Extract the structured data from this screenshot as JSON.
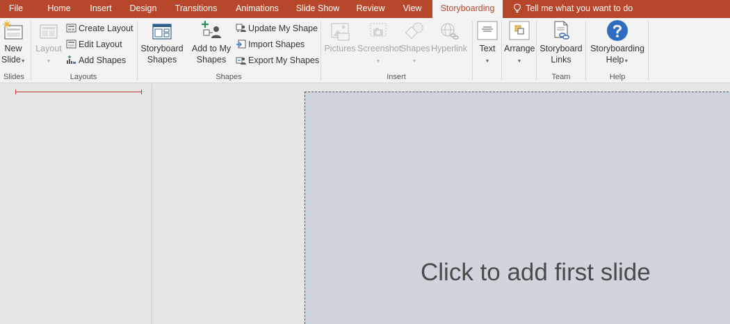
{
  "tabs": {
    "file": "File",
    "home": "Home",
    "insert": "Insert",
    "design": "Design",
    "transitions": "Transitions",
    "animations": "Animations",
    "slideshow": "Slide Show",
    "review": "Review",
    "view": "View",
    "storyboarding": "Storyboarding",
    "tellme": "Tell me what you want to do"
  },
  "ribbon": {
    "slides": {
      "group_label": "Slides",
      "new_slide_line1": "New",
      "new_slide_line2": "Slide"
    },
    "layouts": {
      "group_label": "Layouts",
      "layout": "Layout",
      "create_layout": "Create Layout",
      "edit_layout": "Edit Layout",
      "add_shapes": "Add Shapes"
    },
    "shapes": {
      "group_label": "Shapes",
      "storyboard_shapes_line1": "Storyboard",
      "storyboard_shapes_line2": "Shapes",
      "add_to_my_shapes_line1": "Add to My",
      "add_to_my_shapes_line2": "Shapes",
      "update_my_shape": "Update My Shape",
      "import_shapes": "Import Shapes",
      "export_my_shapes": "Export My Shapes"
    },
    "insert": {
      "group_label": "Insert",
      "pictures": "Pictures",
      "screenshot": "Screenshot",
      "shapes": "Shapes",
      "hyperlink": "Hyperlink"
    },
    "text_arrange": {
      "text": "Text",
      "arrange": "Arrange"
    },
    "team": {
      "group_label": "Team",
      "storyboard_links_line1": "Storyboard",
      "storyboard_links_line2": "Links"
    },
    "help": {
      "group_label": "Help",
      "storyboarding_help_line1": "Storyboarding",
      "storyboarding_help_line2": "Help"
    }
  },
  "slide": {
    "placeholder": "Click to add first slide"
  },
  "colors": {
    "accent": "#b7472a",
    "slide_background": "#d0d4dd",
    "help_icon": "#2e6dbf"
  },
  "icons": {
    "new_slide": "new-slide-icon",
    "layout": "layout-icon",
    "create_layout": "create-layout-icon",
    "edit_layout": "edit-layout-icon",
    "add_shapes": "add-shapes-icon",
    "storyboard_shapes": "storyboard-shapes-icon",
    "add_to_my_shapes": "add-to-my-shapes-icon",
    "update_my_shape": "update-my-shape-icon",
    "import_shapes": "import-shapes-icon",
    "export_my_shapes": "export-my-shapes-icon",
    "pictures": "pictures-icon",
    "screenshot": "screenshot-icon",
    "shapes": "shapes-icon",
    "hyperlink": "hyperlink-icon",
    "text": "text-icon",
    "arrange": "arrange-icon",
    "storyboard_links": "storyboard-links-icon",
    "storyboarding_help": "help-icon",
    "tellme": "lightbulb-icon"
  }
}
